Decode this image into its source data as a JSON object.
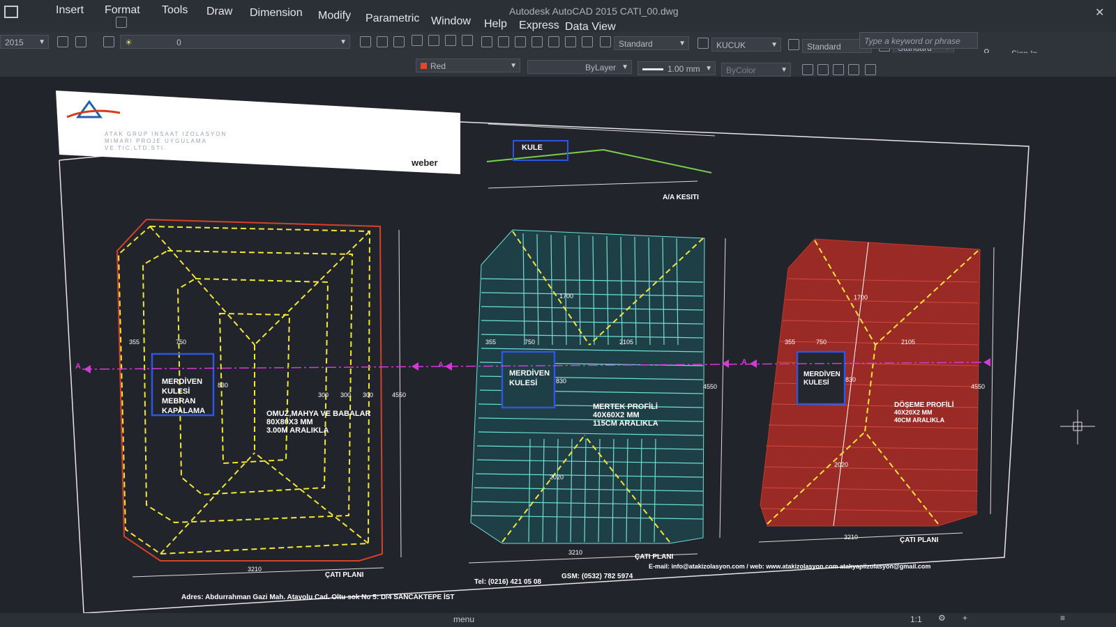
{
  "app": {
    "title": "Autodesk AutoCAD 2015   CATI_00.dwg",
    "version_badge": "2015"
  },
  "menu": {
    "items": [
      "Insert",
      "Format",
      "Tools",
      "Draw",
      "Dimension",
      "Modify",
      "Parametric",
      "Window",
      "Help",
      "Express",
      "Data View"
    ]
  },
  "search": {
    "placeholder": "Type a keyword or phrase"
  },
  "account": {
    "signin": "Sign In"
  },
  "toolbar": {
    "layer_value": "0",
    "color_value": "Red",
    "linetype_value": "ByLayer",
    "lineweight_value": "1.00 mm",
    "plotstyle_value": "ByColor",
    "textstyle_value": "Standard",
    "dimstyle_value": "KUCUK",
    "tablestyle_value": "Standard",
    "mleaderstyle_value": "Standard"
  },
  "drawing": {
    "title_block": {
      "company_line1": "ATAK GRUP INSAAT IZOLASYON",
      "company_line2": "MIMARI PROJE UYGULAMA",
      "company_line3": "VE TIC.LTD.STI.",
      "brand": "weber"
    },
    "section": {
      "tower_label": "KULE",
      "caption": "A/A KESITI"
    },
    "plan1": {
      "stair_label": [
        "MERDİVEN",
        "KULESİ",
        "MEBRAN",
        "KAPALAMA"
      ],
      "note": [
        "OMUZ,MAHYA VE BABALAR",
        "80X80X3 MM",
        "3.00M ARALIKLA"
      ],
      "dims": {
        "d355": "355",
        "d750": "750",
        "d300a": "300",
        "d300b": "300",
        "d300c": "300",
        "d830": "830",
        "d4550": "4550",
        "d3210": "3210"
      },
      "caption": "ÇATI PLANI",
      "section_mark": "A"
    },
    "plan2": {
      "stair_label": [
        "MERDİVEN",
        "KULESİ"
      ],
      "note": [
        "MERTEK PROFİLİ",
        "40X60X2 MM",
        "115CM ARALIKLA"
      ],
      "dims": {
        "d355": "355",
        "d750": "750",
        "d2105": "2105",
        "d1700": "1700",
        "d2020": "2020",
        "d830": "830",
        "d4550": "4550",
        "d3210": "3210"
      },
      "caption": "ÇATI PLANI",
      "section_mark": "A"
    },
    "plan3": {
      "stair_label": [
        "MERDİVEN",
        "KULESİ"
      ],
      "note": [
        "DÖŞEME PROFİLİ",
        "40X20X2 MM",
        "40CM ARALIKLA"
      ],
      "dims": {
        "d355": "355",
        "d750": "750",
        "d2105": "2105",
        "d1700": "1700",
        "d2020": "2020",
        "d830": "830",
        "d4550": "4550",
        "d3210": "3210"
      },
      "caption": "ÇATI PLANI",
      "section_mark": "A"
    },
    "footer": {
      "address": "Adres: Abdurrahman Gazi Mah. Atayolu Cad. Oltu sok No 5: D/4 SANCAKTEPE İST",
      "tel": "Tel: (0216) 421 05 08",
      "gsm": "GSM: (0532) 782 5974",
      "email": "E-mail: info@atakizolasyon.com / web: www.atakizolasyon.com  atakyapiizolasyon@gmail.com"
    }
  },
  "status": {
    "scale": "1:1",
    "menu_hint": "menu"
  },
  "colors": {
    "background": "#21252b",
    "red": "#c0392b",
    "yellow": "#f3e73a",
    "cyan": "#6fe0d6",
    "magenta": "#d63ad6",
    "blue": "#2f56e0"
  }
}
